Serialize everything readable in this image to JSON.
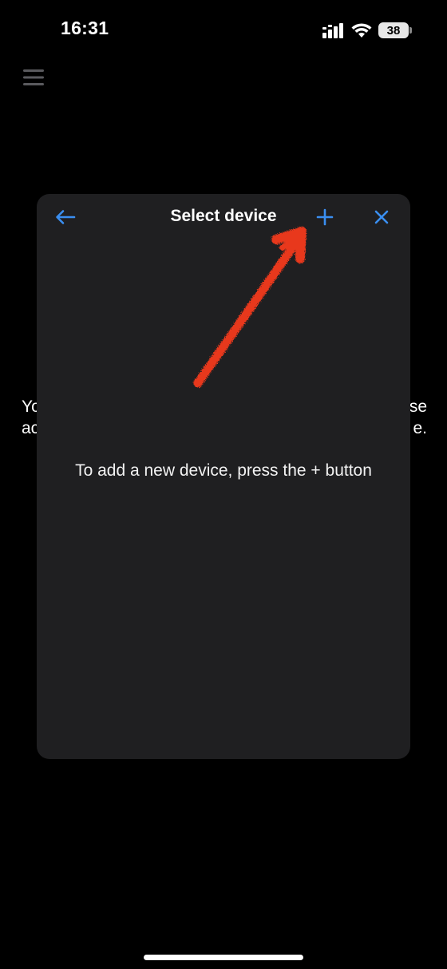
{
  "status_bar": {
    "time": "16:31",
    "battery_level": "38",
    "icons": [
      "cellular-signal-icon",
      "wifi-icon",
      "battery-icon"
    ]
  },
  "header": {
    "menu_icon": "hamburger-menu-icon"
  },
  "background": {
    "left_fragment_1": "Yo",
    "left_fragment_2": "ac",
    "right_fragment_1": "se",
    "right_fragment_2": "e."
  },
  "dialog": {
    "title": "Select device",
    "back_icon": "arrow-left-icon",
    "add_icon": "plus-icon",
    "close_icon": "close-icon",
    "empty_message": "To add a new device, press the + button",
    "accent_color": "#3a8ef0"
  },
  "annotation": {
    "type": "hand-drawn-arrow",
    "color": "#e8391d",
    "points_to": "add-button"
  }
}
